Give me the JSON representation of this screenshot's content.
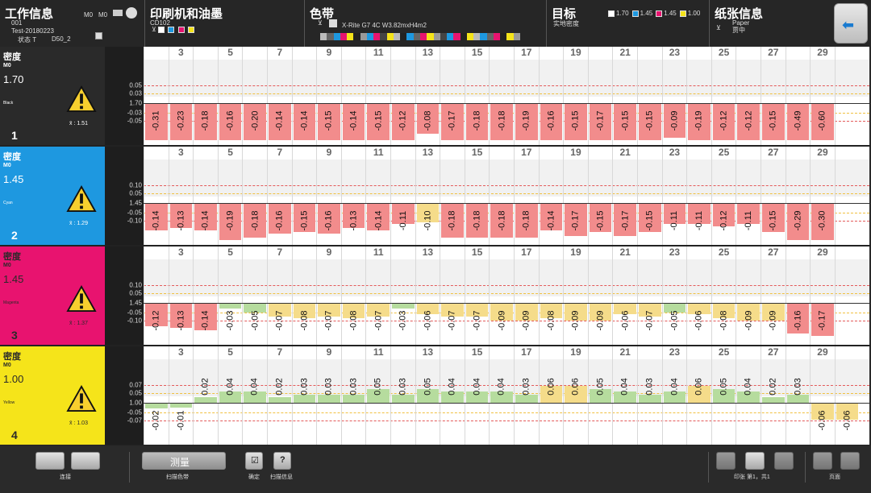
{
  "header": {
    "job_title": "工作信息",
    "job_number": "001",
    "job_name": "Test-20180223",
    "status_label": "状态 T",
    "illuminant": "D50_2",
    "mode_a": "M0",
    "mode_b": "M0",
    "press_title": "印刷机和油墨",
    "press_code": "CD102",
    "colorbar_title": "色带",
    "colorbar_name": "X-Rite G7 4C W3.82mxH4m2",
    "target_title": "目标",
    "target_sub": "实地密度",
    "target_values": [
      {
        "value": "1.70",
        "color": "#ffffff"
      },
      {
        "value": "1.45",
        "color": "#1e98e0"
      },
      {
        "value": "1.45",
        "color": "#e8136f"
      },
      {
        "value": "1.00",
        "color": "#f5e41a"
      }
    ],
    "paper_title": "纸张信息",
    "paper_name": "Paper",
    "paper_type": "贾中",
    "strip_colors": [
      "#bbbbbb",
      "#666666",
      "#1e98e0",
      "#e8136f",
      "#f5e41a",
      "#222222",
      "#999999",
      "#1e98e0",
      "#e8136f",
      "#444444",
      "#f5e41a",
      "#bbbbbb",
      "#222222",
      "#1e98e0",
      "#666666",
      "#e8136f",
      "#f5e41a",
      "#999999",
      "#444444",
      "#1e98e0",
      "#e8136f",
      "#222222",
      "#f5e41a",
      "#bbbbbb",
      "#1e98e0",
      "#666666",
      "#e8136f",
      "#222222",
      "#f5e41a",
      "#999999"
    ]
  },
  "column_numbers": [
    "",
    "3",
    "",
    "5",
    "",
    "7",
    "",
    "9",
    "",
    "11",
    "",
    "13",
    "",
    "15",
    "",
    "17",
    "",
    "19",
    "",
    "21",
    "",
    "23",
    "",
    "25",
    "",
    "27",
    "",
    "29",
    ""
  ],
  "rows": [
    {
      "title": "密度",
      "mode": "M0",
      "target": "1.70",
      "ink_name": "Black",
      "avg": "x̄ : 1.51",
      "num": "1",
      "bg": "#2a2a2a",
      "fg": "#ffffff",
      "scale_labels": [
        "0.05",
        "0.03",
        "1.70",
        "-0.03",
        "-0.05"
      ],
      "values": [
        "-0.31",
        "-0.23",
        "-0.18",
        "-0.16",
        "-0.20",
        "-0.14",
        "-0.14",
        "-0.15",
        "-0.14",
        "-0.15",
        "-0.12",
        "-0.08",
        "-0.17",
        "-0.18",
        "-0.18",
        "-0.19",
        "-0.16",
        "-0.15",
        "-0.17",
        "-0.15",
        "-0.15",
        "-0.09",
        "-0.19",
        "-0.12",
        "-0.12",
        "-0.15",
        "-0.49",
        "-0.60"
      ]
    },
    {
      "title": "密度",
      "mode": "M0",
      "target": "1.45",
      "ink_name": "Cyan",
      "avg": "x̄ : 1.29",
      "num": "2",
      "bg": "#1e98e0",
      "fg": "#ffffff",
      "scale_labels": [
        "0.10",
        "0.05",
        "1.45",
        "-0.05",
        "-0.10"
      ],
      "values": [
        "-0.14",
        "-0.13",
        "-0.14",
        "-0.19",
        "-0.18",
        "-0.16",
        "-0.15",
        "-0.16",
        "-0.13",
        "-0.14",
        "-0.11",
        "-0.10",
        "-0.18",
        "-0.18",
        "-0.18",
        "-0.18",
        "-0.14",
        "-0.17",
        "-0.15",
        "-0.17",
        "-0.15",
        "-0.11",
        "-0.11",
        "-0.12",
        "-0.11",
        "-0.15",
        "-0.29",
        "-0.30"
      ]
    },
    {
      "title": "密度",
      "mode": "M0",
      "target": "1.45",
      "ink_name": "Magenta",
      "avg": "x̄ : 1.37",
      "num": "3",
      "bg": "#e8136f",
      "fg": "#2a2a2a",
      "scale_labels": [
        "0.10",
        "0.05",
        "1.45",
        "-0.05",
        "-0.10"
      ],
      "values": [
        "-0.12",
        "-0.13",
        "-0.14",
        "-0.03",
        "-0.05",
        "-0.07",
        "-0.08",
        "-0.07",
        "-0.08",
        "-0.07",
        "-0.03",
        "-0.06",
        "-0.07",
        "-0.07",
        "-0.09",
        "-0.09",
        "-0.08",
        "-0.09",
        "-0.09",
        "-0.06",
        "-0.07",
        "-0.05",
        "-0.06",
        "-0.08",
        "-0.09",
        "-0.09",
        "-0.16",
        "-0.17"
      ]
    },
    {
      "title": "密度",
      "mode": "M0",
      "target": "1.00",
      "ink_name": "Yellow",
      "avg": "x̄ : 1.03",
      "num": "4",
      "bg": "#f5e41a",
      "fg": "#2a2a2a",
      "scale_labels": [
        "0.07",
        "0.05",
        "1.00",
        "-0.05",
        "-0.07"
      ],
      "values": [
        "-0.02",
        "-0.01",
        "0.02",
        "0.04",
        "0.04",
        "0.02",
        "0.03",
        "0.03",
        "0.03",
        "0.05",
        "0.03",
        "0.05",
        "0.04",
        "0.04",
        "0.04",
        "0.03",
        "0.06",
        "0.06",
        "0.05",
        "0.04",
        "0.03",
        "0.04",
        "0.06",
        "0.05",
        "0.04",
        "0.02",
        "0.03",
        "-0.06",
        "-0.06"
      ]
    }
  ],
  "footer": {
    "connect_label": "连接",
    "measure_label": "测量",
    "scan_bar_label": "扫描色带",
    "confirm_label": "确定",
    "scan_info_label": "扫描信息",
    "sheet_label": "印张 第1，共1",
    "page_label": "页面"
  },
  "colors": {
    "red": "#f28c8c",
    "yellow": "#f5dc8a",
    "green": "#b6dc9e",
    "redline": "#e35a5a",
    "yellowline": "#f0c040"
  }
}
